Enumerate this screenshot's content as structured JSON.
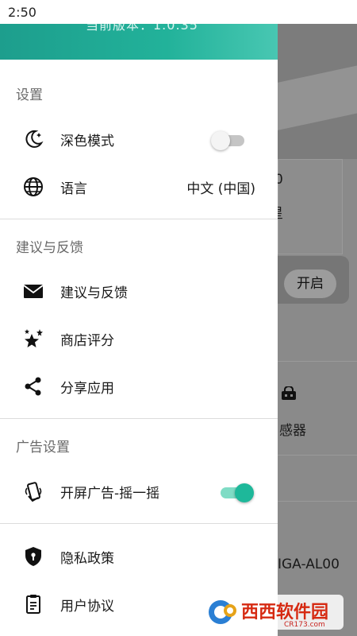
{
  "status_bar": {
    "time": "2:50"
  },
  "drawer": {
    "version": "当前版本：1.0.35",
    "sections": [
      {
        "title": "设置"
      },
      {
        "title": "建议与反馈"
      },
      {
        "title": "广告设置"
      }
    ],
    "items": {
      "dark_mode": {
        "label": "深色模式",
        "icon": "moon-stars-icon",
        "toggle_on": false
      },
      "language": {
        "label": "语言",
        "value": "中文 (中国)",
        "icon": "globe-icon"
      },
      "feedback": {
        "label": "建议与反馈",
        "icon": "mail-icon"
      },
      "rate": {
        "label": "商店评分",
        "icon": "stars-icon"
      },
      "share": {
        "label": "分享应用",
        "icon": "share-icon"
      },
      "splash_ad": {
        "label": "开屏广告-摇一摇",
        "icon": "shake-phone-icon",
        "toggle_on": true
      },
      "privacy": {
        "label": "隐私政策",
        "icon": "shield-icon"
      },
      "terms": {
        "label": "用户协议",
        "icon": "document-icon"
      }
    }
  },
  "background": {
    "partial_text_1": "0",
    "partial_text_2": "星",
    "button": "开启",
    "partial_text_3": "感器",
    "partial_text_4": "IGA-AL00"
  },
  "watermark": {
    "brand": "西西软件园",
    "url": "CR173.com"
  },
  "colors": {
    "accent": "#1eb89a",
    "header_start": "#1d9e8d",
    "header_end": "#48c7b2"
  }
}
